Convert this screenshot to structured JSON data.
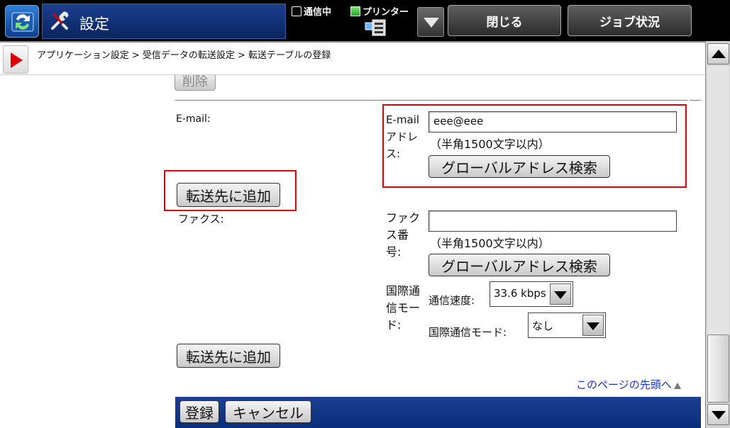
{
  "header": {
    "title": "設定",
    "status_comm": "通信中",
    "status_printer": "プリンター",
    "close_label": "閉じる",
    "job_status_label": "ジョブ状況"
  },
  "breadcrumb": "アプリケーション設定 > 受信データの転送設定 > 転送テーブルの登録",
  "form": {
    "delete_label": "削除",
    "email": {
      "section_label": "E-mail:",
      "field_label_lines": [
        "E-mail",
        "アドレ",
        "ス:"
      ],
      "value": "eee@eee",
      "hint": "（半角1500文字以内）",
      "search_label": "グローバルアドレス検索"
    },
    "add_destination_1": "転送先に追加",
    "fax": {
      "section_label": "ファクス:",
      "field_label_lines": [
        "ファク",
        "ス番",
        "号:"
      ],
      "value": "",
      "hint": "（半角1500文字以内）",
      "search_label": "グローバルアドレス検索",
      "intl_mode_label_lines": [
        "国際通",
        "信モー",
        "ド:"
      ],
      "speed_label": "通信速度:",
      "speed_value": "33.6 kbps",
      "intl_mode_sub_label": "国際通信モード:",
      "intl_mode_value": "なし"
    },
    "add_destination_2": "転送先に追加",
    "page_top_link": "このページの先頭へ"
  },
  "footer": {
    "register_label": "登録",
    "cancel_label": "キャンセル"
  },
  "colors": {
    "accent_blue": "#0a2e7a",
    "highlight_red": "#e00000",
    "link_blue": "#1a33cc"
  },
  "icons": {
    "app": "refresh-sync-icon",
    "settings": "tools-icon",
    "dropdown": "chevron-down-icon",
    "breadcrumb": "play-arrow-icon"
  }
}
